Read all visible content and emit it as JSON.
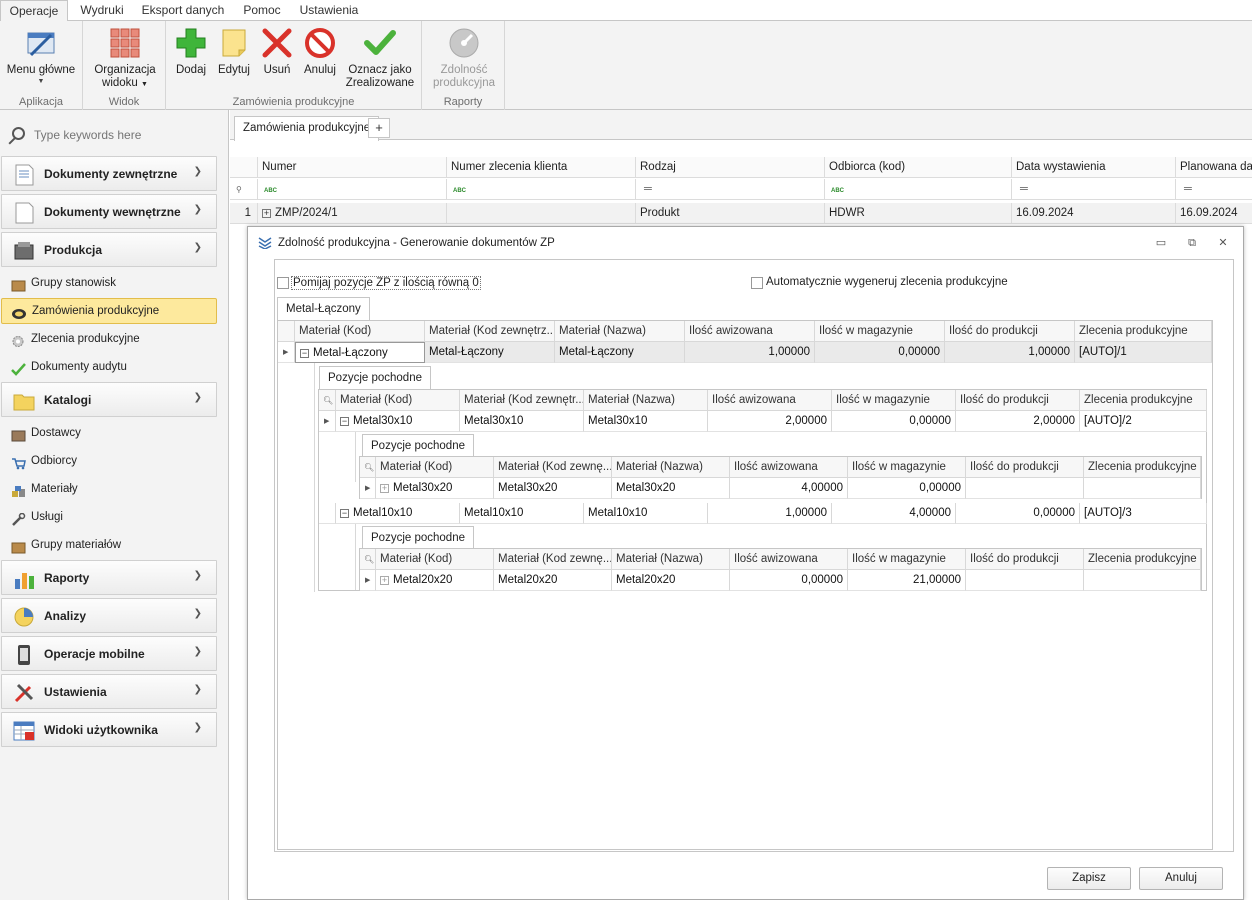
{
  "ribbon": {
    "tabs": [
      "Operacje",
      "Wydruki",
      "Eksport danych",
      "Pomoc",
      "Ustawienia"
    ],
    "groups": {
      "aplikacja": "Aplikacja",
      "widok": "Widok",
      "zamowienia": "Zamówienia produkcyjne",
      "raporty": "Raporty"
    },
    "buttons": {
      "menu_line1": "Menu główne",
      "org_line1": "Organizacja",
      "org_line2": "widoku",
      "dodaj": "Dodaj",
      "edytuj": "Edytuj",
      "usun": "Usuń",
      "anuluj": "Anuluj",
      "oznacz_line1": "Oznacz jako",
      "oznacz_line2": "Zrealizowane",
      "zdol_line1": "Zdolność",
      "zdol_line2": "produkcyjna"
    }
  },
  "sidebar": {
    "search_placeholder": "Type keywords here",
    "groups": [
      "Dokumenty zewnętrzne",
      "Dokumenty wewnętrzne",
      "Produkcja",
      "Katalogi",
      "Raporty",
      "Analizy",
      "Operacje mobilne",
      "Ustawienia",
      "Widoki użytkownika"
    ],
    "produkcja_items": [
      "Grupy stanowisk",
      "Zamówienia produkcyjne",
      "Zlecenia produkcyjne",
      "Dokumenty audytu"
    ],
    "katalogi_items": [
      "Dostawcy",
      "Odbiorcy",
      "Materiały",
      "Usługi",
      "Grupy materiałów"
    ]
  },
  "main": {
    "doc_tab": "Zamówienia produkcyjne",
    "add_tab": "+",
    "columns": [
      "Numer",
      "Numer zlecenia klienta",
      "Rodzaj",
      "Odbiorca (kod)",
      "Data wystawienia",
      "Planowana data"
    ],
    "row": {
      "index": "1",
      "numer": "ZMP/2024/1",
      "numer_klienta": "",
      "rodzaj": "Produkt",
      "odbiorca": "HDWR",
      "data": "16.09.2024",
      "planowana": "16.09.2024"
    }
  },
  "dialog": {
    "title": "Zdolność produkcyjna - Generowanie dokumentów ZP",
    "cb1": "Pomijaj pozycje ZP z ilością równą 0",
    "cb2": "Automatycznie wygeneruj zlecenia produkcyjne",
    "tab": "Metal-Łączony",
    "detail_tab": "Pozycje pochodne",
    "cols": [
      "Materiał (Kod)",
      "Materiał (Kod zewnętrz...",
      "Materiał (Nazwa)",
      "Ilość awizowana",
      "Ilość w magazynie",
      "Ilość do produkcji",
      "Zlecenia produkcyjne"
    ],
    "cols2": [
      "Materiał (Kod)",
      "Materiał (Kod zewnętr...",
      "Materiał (Nazwa)",
      "Ilość awizowana",
      "Ilość w magazynie",
      "Ilość do produkcji",
      "Zlecenia produkcyjne"
    ],
    "cols3": [
      "Materiał (Kod)",
      "Materiał (Kod zewnę...",
      "Materiał (Nazwa)",
      "Ilość awizowana",
      "Ilość w magazynie",
      "Ilość do produkcji",
      "Zlecenia produkcyjne"
    ],
    "top_row": [
      "Metal-Łączony",
      "Metal-Łączony",
      "Metal-Łączony",
      "1,00000",
      "0,00000",
      "1,00000",
      "[AUTO]/1"
    ],
    "l2_row1": [
      "Metal30x10",
      "Metal30x10",
      "Metal30x10",
      "2,00000",
      "0,00000",
      "2,00000",
      "[AUTO]/2"
    ],
    "l3_row1": [
      "Metal30x20",
      "Metal30x20",
      "Metal30x20",
      "4,00000",
      "0,00000",
      "",
      ""
    ],
    "l2_row2": [
      "Metal10x10",
      "Metal10x10",
      "Metal10x10",
      "1,00000",
      "4,00000",
      "0,00000",
      "[AUTO]/3"
    ],
    "l3_row2": [
      "Metal20x20",
      "Metal20x20",
      "Metal20x20",
      "0,00000",
      "21,00000",
      "",
      ""
    ],
    "save": "Zapisz",
    "cancel": "Anuluj"
  }
}
